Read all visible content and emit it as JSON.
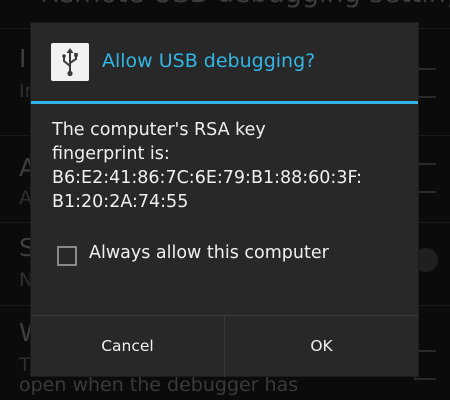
{
  "background": {
    "title_fragment": "Remote USB debugging settings",
    "rows": [
      {
        "primary": "I",
        "secondary": "In"
      },
      {
        "primary": "A",
        "secondary": "A"
      },
      {
        "primary": "S",
        "secondary": "N"
      },
      {
        "primary": "W",
        "secondary": "T"
      }
    ],
    "bottom_text": "open when the debugger has"
  },
  "dialog": {
    "icon": "usb-icon",
    "title": "Allow USB debugging?",
    "message_lines": [
      "The computer's RSA key",
      "fingerprint is:",
      "B6:E2:41:86:7C:6E:79:B1:88:60:3F:",
      "B1:20:2A:74:55"
    ],
    "checkbox_label": "Always allow this computer",
    "checkbox_checked": false,
    "cancel_label": "Cancel",
    "ok_label": "OK"
  },
  "colors": {
    "accent": "#33b5e5",
    "dialog_bg": "#282828"
  }
}
